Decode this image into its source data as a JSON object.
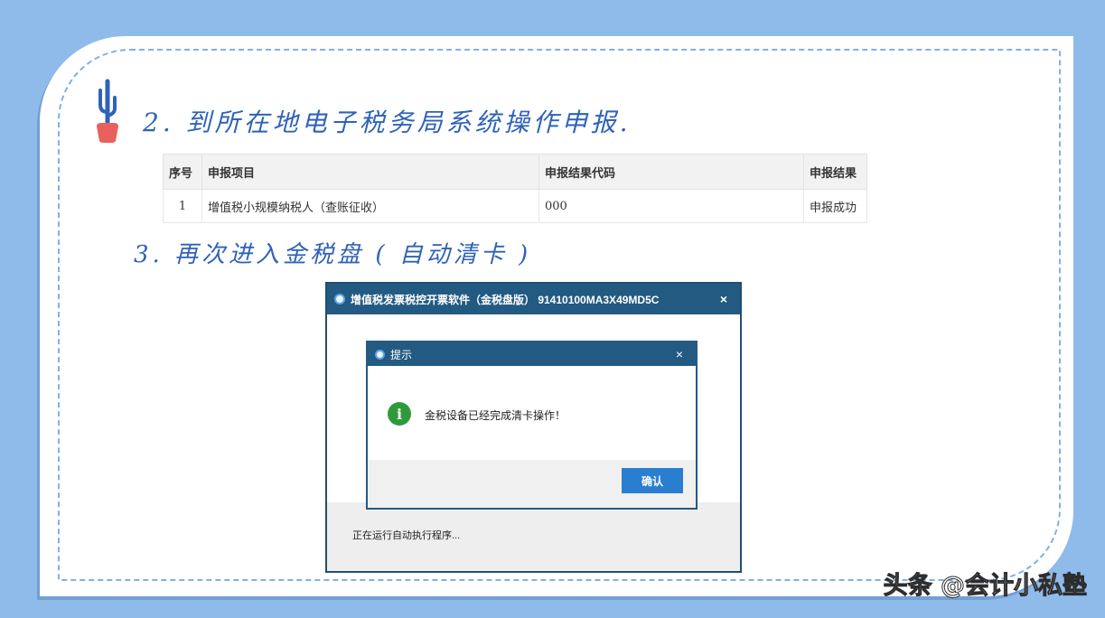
{
  "steps": {
    "step2": "2. 到所在地电子税务局系统操作申报.",
    "step3": "3. 再次进入金税盘 ( 自动清卡 )"
  },
  "result_table": {
    "headers": [
      "序号",
      "申报项目",
      "申报结果代码",
      "申报结果"
    ],
    "rows": [
      [
        "1",
        "增值税小规模纳税人（查账征收）",
        "000",
        "申报成功"
      ]
    ]
  },
  "app_window": {
    "title": "增值税发票税控开票软件（金税盘版） 91410100MA3X49MD5C",
    "close_glyph": "×",
    "status": "正在运行自动执行程序..."
  },
  "dialog": {
    "title": "提示",
    "close_glyph": "×",
    "info_glyph": "i",
    "message": "金税设备已经完成清卡操作！",
    "confirm_label": "确认"
  },
  "watermark": "头条 @会计小私塾",
  "colors": {
    "background": "#8fbbeb",
    "heading": "#2f62b8",
    "titlebar": "#235a82",
    "confirm": "#2a7ed0"
  }
}
